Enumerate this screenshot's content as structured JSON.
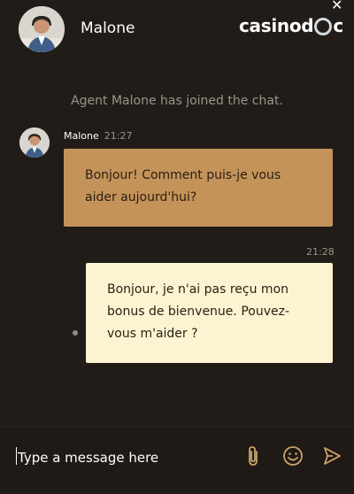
{
  "header": {
    "agent_name": "Malone",
    "brand": {
      "pre": "casinod",
      "post": "c"
    },
    "close_symbol": "✕",
    "menu_icon": "ellipsis-icon",
    "close_icon": "close-icon"
  },
  "chat": {
    "system_message": "Agent Malone has joined the chat.",
    "agent_message": {
      "sender": "Malone",
      "time": "21:27",
      "text": "Bonjour! Comment puis-je vous aider aujourd'hui?"
    },
    "user_message": {
      "time": "21:28",
      "text": "Bonjour, je n'ai pas reçu mon bonus de bienvenue. Pouvez-vous m'aider ?"
    }
  },
  "composer": {
    "placeholder": "Type a message here",
    "icons": [
      "paperclip-icon",
      "emoji-icon",
      "send-icon"
    ]
  },
  "colors": {
    "background": "#211c17",
    "agent_bubble": "#c4935a",
    "user_bubble": "#fbf3d2",
    "icon": "#c9a36a"
  }
}
